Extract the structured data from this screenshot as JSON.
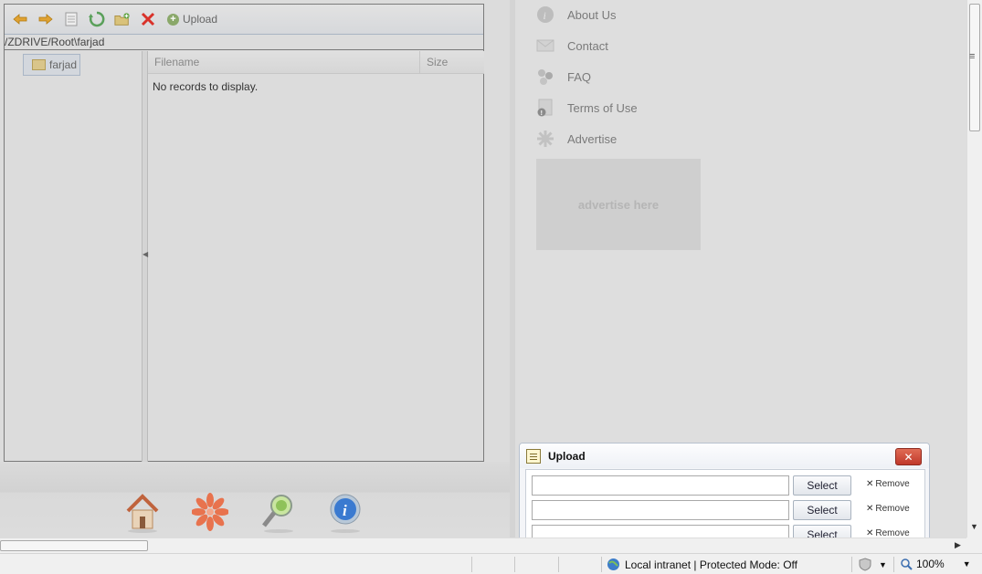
{
  "file_manager": {
    "toolbar": {
      "icons": [
        "back-arrow-icon",
        "forward-arrow-icon",
        "properties-icon",
        "refresh-icon",
        "new-folder-icon",
        "delete-icon"
      ],
      "upload_label": "Upload"
    },
    "path": "/ZDRIVE/Root\\farjad",
    "tree": {
      "folder_label": "farjad"
    },
    "grid": {
      "columns": [
        "Filename",
        "Size"
      ],
      "empty_text": "No records to display."
    }
  },
  "sidebar_links": [
    {
      "label": "About Us",
      "icon": "info-icon"
    },
    {
      "label": "Contact",
      "icon": "envelope-icon"
    },
    {
      "label": "FAQ",
      "icon": "faq-icon"
    },
    {
      "label": "Terms of Use",
      "icon": "terms-icon"
    },
    {
      "label": "Advertise",
      "icon": "advertise-icon"
    }
  ],
  "ad_box": {
    "text": "advertise here"
  },
  "footer_nav": [
    "home-icon",
    "gear-flower-icon",
    "magnifier-icon",
    "info-icon"
  ],
  "upload_dialog": {
    "title": "Upload",
    "rows": [
      {
        "select_label": "Select",
        "remove_label": "Remove"
      },
      {
        "select_label": "Select",
        "remove_label": "Remove"
      },
      {
        "select_label": "Select",
        "remove_label": "Remove"
      }
    ]
  },
  "status_bar": {
    "zone_text": "Local intranet | Protected Mode: Off",
    "zoom_text": "100%"
  }
}
